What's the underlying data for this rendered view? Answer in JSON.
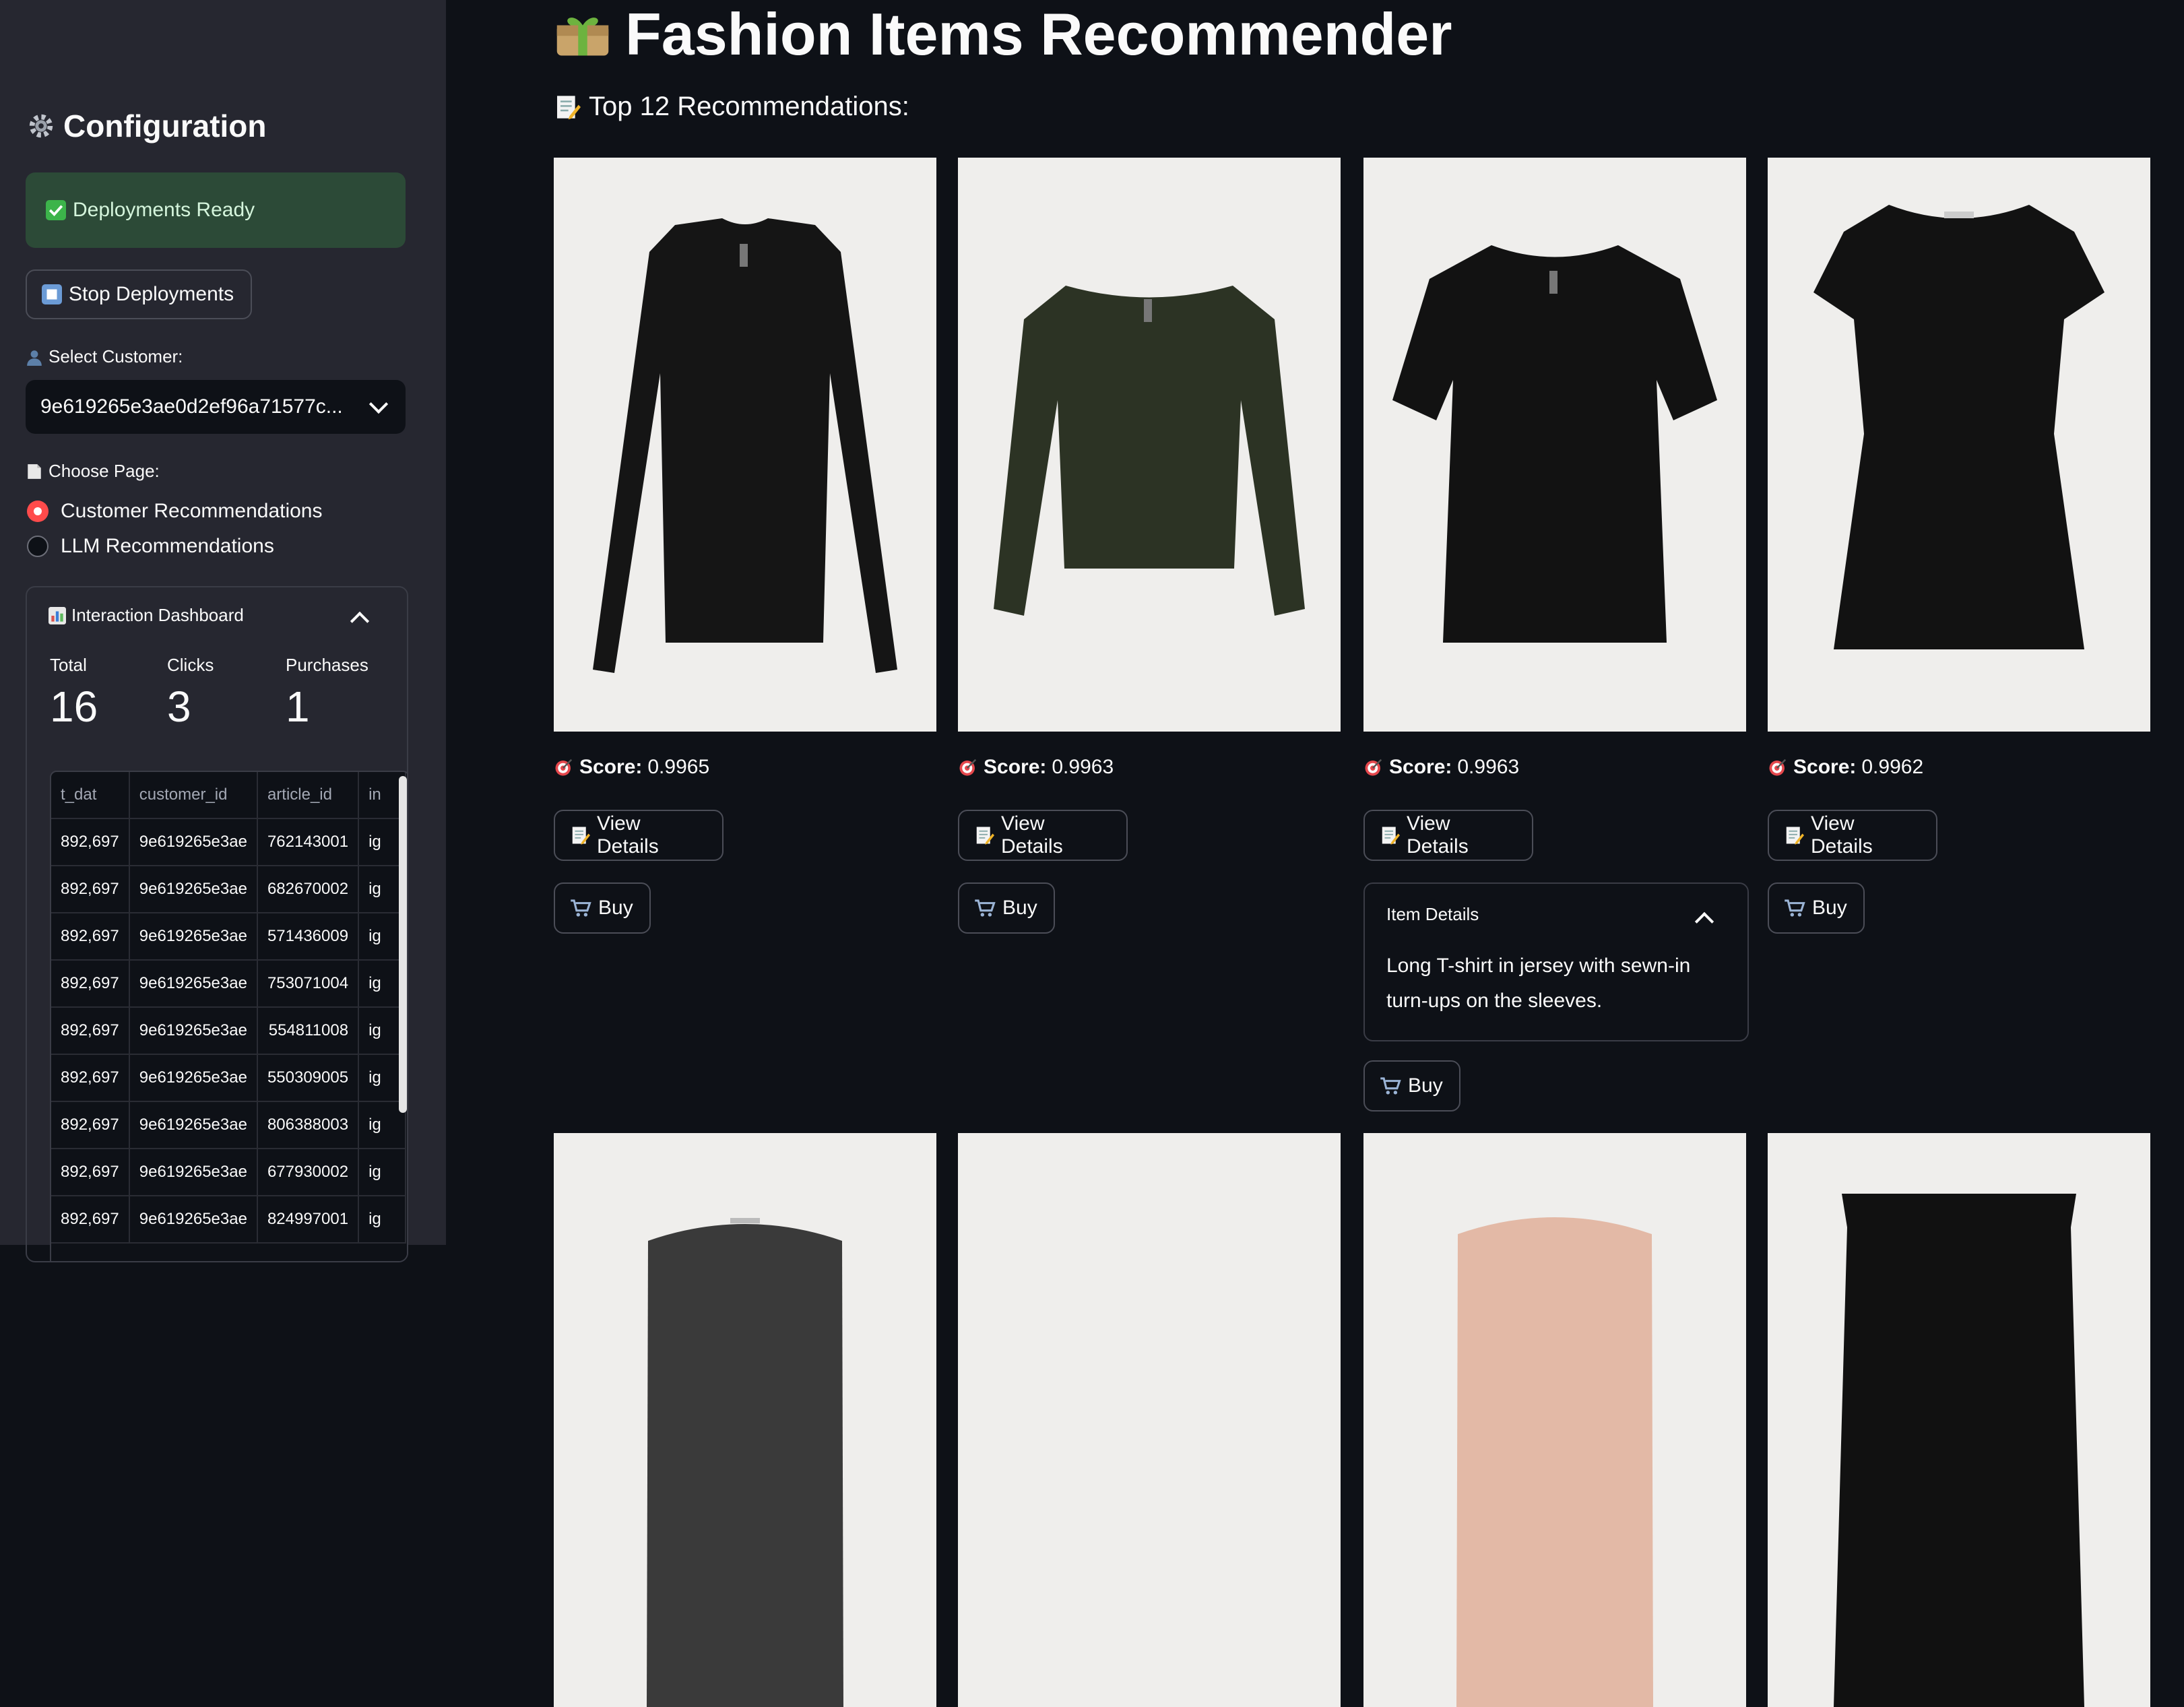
{
  "sidebar": {
    "title": "Configuration",
    "status": "Deployments Ready",
    "stop_button": "Stop Deployments",
    "customer_label": "Select Customer:",
    "customer_value": "9e619265e3ae0d2ef96a71577c...",
    "page_label": "Choose Page:",
    "page_options": [
      "Customer Recommendations",
      "LLM Recommendations"
    ],
    "selected_page": "Customer Recommendations",
    "dashboard": {
      "title": "Interaction Dashboard",
      "metrics": [
        {
          "label": "Total",
          "value": "16"
        },
        {
          "label": "Clicks",
          "value": "3"
        },
        {
          "label": "Purchases",
          "value": "1"
        }
      ],
      "columns": [
        "t_dat",
        "customer_id",
        "article_id",
        "in"
      ],
      "rows": [
        [
          "892,697",
          "9e619265e3ae",
          "762143001",
          "ig"
        ],
        [
          "892,697",
          "9e619265e3ae",
          "682670002",
          "ig"
        ],
        [
          "892,697",
          "9e619265e3ae",
          "571436009",
          "ig"
        ],
        [
          "892,697",
          "9e619265e3ae",
          "753071004",
          "ig"
        ],
        [
          "892,697",
          "9e619265e3ae",
          "554811008",
          "ig"
        ],
        [
          "892,697",
          "9e619265e3ae",
          "550309005",
          "ig"
        ],
        [
          "892,697",
          "9e619265e3ae",
          "806388003",
          "ig"
        ],
        [
          "892,697",
          "9e619265e3ae",
          "677930002",
          "ig"
        ],
        [
          "892,697",
          "9e619265e3ae",
          "824997001",
          "ig"
        ]
      ]
    }
  },
  "main": {
    "title": "Fashion Items Recommender",
    "subtitle": "Top 12 Recommendations:",
    "score_label": "Score:",
    "view_details_label": "View Details",
    "buy_label": "Buy",
    "items": [
      {
        "score": "0.9965"
      },
      {
        "score": "0.9963"
      },
      {
        "score": "0.9963"
      },
      {
        "score": "0.9962"
      }
    ],
    "item_details": {
      "title": "Item Details",
      "text": "Long T-shirt in jersey with sewn-in turn-ups on the sleeves."
    }
  },
  "colors": {
    "background": "#0e1117",
    "sidebar": "#262730",
    "accent": "#ff4b4b",
    "success_bg": "#2c4a37"
  },
  "icons": [
    "gear-icon",
    "check-icon",
    "stop-icon",
    "user-icon",
    "page-icon",
    "chart-icon",
    "chevron-down-icon",
    "chevron-up-icon",
    "gift-icon",
    "memo-icon",
    "target-icon",
    "cart-icon"
  ]
}
